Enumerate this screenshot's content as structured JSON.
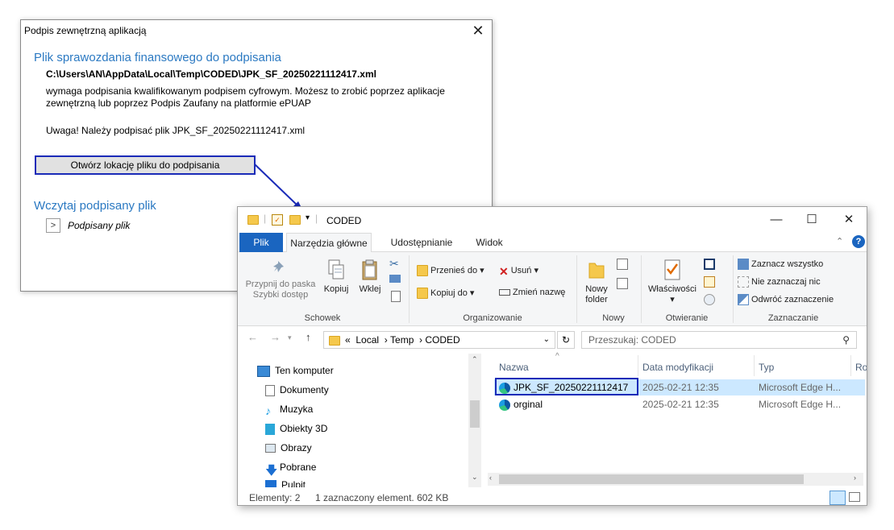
{
  "dialog": {
    "title": "Podpis zewnętrzną aplikacją",
    "close_glyph": "✕",
    "heading1": "Plik sprawozdania finansowego do podpisania",
    "file_path": "C:\\Users\\AN\\AppData\\Local\\Temp\\CODED\\JPK_SF_20250221112417.xml",
    "description_line1": "wymaga podpisania kwalifikowanym podpisem cyfrowym. Możesz to zrobić poprzez aplikacje",
    "description_line2": "zewnętrzną lub poprzez Podpis Zaufany na platformie ePUAP",
    "warning": "Uwaga! Należy podpisać plik JPK_SF_20250221112417.xml",
    "open_location_button": "Otwórz lokację pliku do podpisania",
    "heading2": "Wczytaj podpisany plik",
    "expander_glyph": ">",
    "signed_file_label": "Podpisany plik"
  },
  "explorer": {
    "title": "CODED",
    "window_buttons": {
      "minimize": "—",
      "maximize": "☐",
      "close": "✕"
    },
    "tabs": [
      "Plik",
      "Narzędzia główne",
      "Udostępnianie",
      "Widok"
    ],
    "help_glyph": "?",
    "collapse_glyph": "⌃",
    "ribbon": {
      "clipboard": {
        "pin_label_1": "Przypnij do paska",
        "pin_label_2": "Szybki dostęp",
        "copy": "Kopiuj",
        "paste": "Wklej",
        "group": "Schowek"
      },
      "organize": {
        "move_to": "Przenieś do",
        "copy_to": "Kopiuj do",
        "delete": "Usuń",
        "rename": "Zmień nazwę",
        "group": "Organizowanie"
      },
      "new": {
        "new_folder_1": "Nowy",
        "new_folder_2": "folder",
        "group": "Nowy"
      },
      "open": {
        "properties": "Właściwości",
        "group": "Otwieranie"
      },
      "select": {
        "select_all": "Zaznacz wszystko",
        "select_none": "Nie zaznaczaj nic",
        "invert": "Odwróć zaznaczenie",
        "group": "Zaznaczanie"
      }
    },
    "address": {
      "crumbs": [
        "Local",
        "Temp",
        "CODED"
      ],
      "prefix": "«",
      "search_placeholder": "Przeszukaj: CODED"
    },
    "nav_items": [
      "Ten komputer",
      "Dokumenty",
      "Muzyka",
      "Obiekty 3D",
      "Obrazy",
      "Pobrane",
      "Pulpit"
    ],
    "columns": [
      "Nazwa",
      "Data modyfikacji",
      "Typ",
      "Ro"
    ],
    "files": [
      {
        "name": "JPK_SF_20250221112417",
        "date": "2025-02-21 12:35",
        "type": "Microsoft Edge H...",
        "selected": true
      },
      {
        "name": "orginal",
        "date": "2025-02-21 12:35",
        "type": "Microsoft Edge H...",
        "selected": false
      }
    ],
    "status": {
      "items": "Elementy: 2",
      "selection": "1 zaznaczony element. 602 KB"
    }
  },
  "colors": {
    "accent_blue": "#2b79c2",
    "highlight_border": "#1a2bb8",
    "file_tab": "#1a65c0",
    "selection": "#cce8ff"
  }
}
